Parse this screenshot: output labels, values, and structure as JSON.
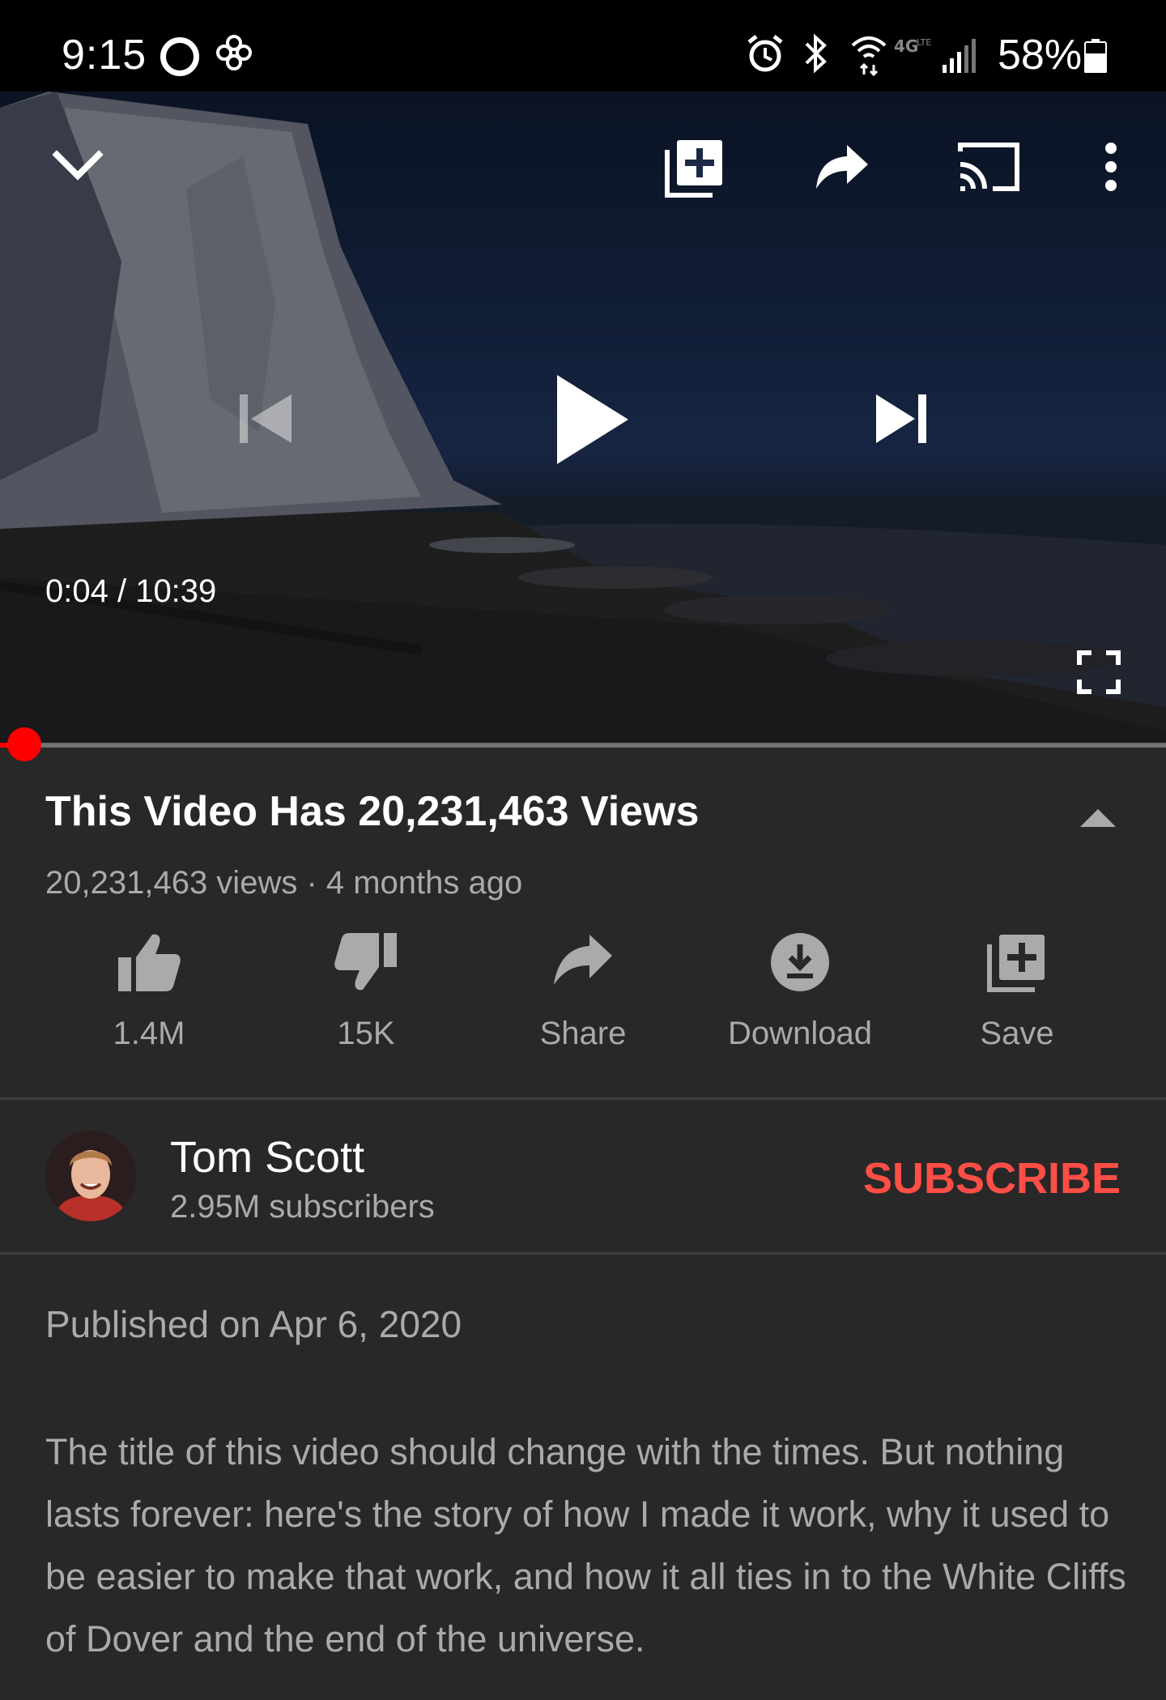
{
  "status_bar": {
    "time": "9:15",
    "battery": "58%",
    "icons": [
      "circle-status-icon",
      "fan-icon",
      "alarm-icon",
      "bluetooth-icon",
      "wifi-icon",
      "lte-icon",
      "signal-icon",
      "battery-icon"
    ]
  },
  "player": {
    "time_display": "0:04 / 10:39",
    "progress_fraction": 0.0064,
    "buffer_fraction": 0.034,
    "icons": [
      "collapse-chevron-icon",
      "add-to-playlist-icon",
      "share-icon",
      "cast-icon",
      "more-vert-icon",
      "previous-icon",
      "play-icon",
      "next-icon",
      "fullscreen-icon"
    ]
  },
  "video": {
    "title": "This Video Has 20,231,463 Views",
    "meta": "20,231,463 views · 4 months ago"
  },
  "actions": [
    {
      "label": "1.4M",
      "icon": "thumbs-up-icon"
    },
    {
      "label": "15K",
      "icon": "thumbs-down-icon"
    },
    {
      "label": "Share",
      "icon": "share-icon"
    },
    {
      "label": "Download",
      "icon": "download-icon"
    },
    {
      "label": "Save",
      "icon": "save-icon"
    }
  ],
  "channel": {
    "name": "Tom Scott",
    "subscribers": "2.95M subscribers",
    "subscribe_label": "SUBSCRIBE"
  },
  "description": {
    "published": "Published on Apr 6, 2020",
    "text": "The title of this video should change with the times. But nothing lasts forever: here's the story of how I made it work, why it used to be easier to make that work, and how it all ties in to the White Cliffs of Dover and the end of the universe."
  },
  "colors": {
    "background": "#282828",
    "accent_red": "#ff0000",
    "subscribe_red": "#ff4e45",
    "secondary_text": "#aaaaaa"
  }
}
